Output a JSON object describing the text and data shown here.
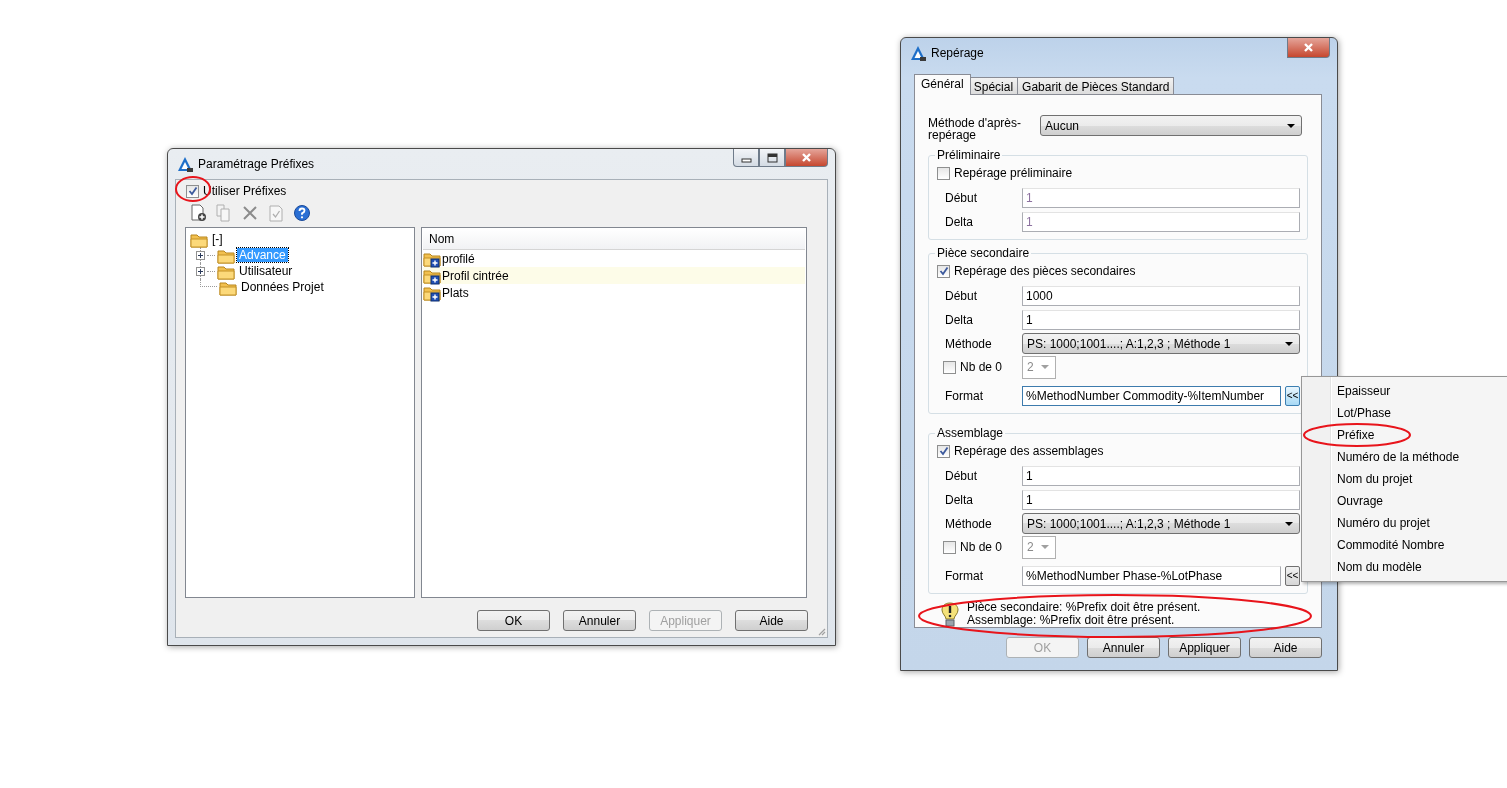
{
  "windows": [
    {
      "kind": "prefixes",
      "title": "Paramétrage Préfixes",
      "use_prefixes": {
        "label": "Utiliser Préfixes",
        "checked": true,
        "highlighted": true
      },
      "toolbar": [
        {
          "kind": "new",
          "disabled": false
        },
        {
          "kind": "copy",
          "disabled": true
        },
        {
          "kind": "delete",
          "disabled": true
        },
        {
          "kind": "check",
          "disabled": true
        },
        {
          "kind": "help",
          "disabled": false
        }
      ],
      "tree": [
        {
          "label": "[-]",
          "selected": false,
          "expandable": false,
          "children": [
            {
              "label": "Advance",
              "selected": true,
              "expandable": true
            },
            {
              "label": "Utilisateur",
              "selected": false,
              "expandable": true
            },
            {
              "label": "Données Projet",
              "selected": false,
              "expandable": false
            }
          ]
        }
      ],
      "list": {
        "columns": [
          "Nom"
        ],
        "rows": [
          {
            "name": "profilé",
            "hovered": false
          },
          {
            "name": "Profil cintrée",
            "hovered": true
          },
          {
            "name": "Plats",
            "hovered": false
          }
        ]
      },
      "buttons": [
        {
          "label": "OK",
          "disabled": false
        },
        {
          "label": "Annuler",
          "disabled": false
        },
        {
          "label": "Appliquer",
          "disabled": true
        },
        {
          "label": "Aide",
          "disabled": false
        }
      ]
    },
    {
      "kind": "numbering",
      "title": "Repérage",
      "tabs": [
        {
          "label": "Général",
          "selected": true
        },
        {
          "label": "Spécial",
          "selected": false
        },
        {
          "label": "Gabarit de Pièces Standard",
          "selected": false
        }
      ],
      "post_method": {
        "label": "Méthode d'après-repérage",
        "value": "Aucun"
      },
      "groups": [
        {
          "title": "Préliminaire",
          "option": {
            "label": "Repérage préliminaire",
            "checked": false
          },
          "fields": [
            {
              "kind": "text",
              "label": "Début",
              "value": "1",
              "disabled": true
            },
            {
              "kind": "text",
              "label": "Delta",
              "value": "1",
              "disabled": true
            }
          ]
        },
        {
          "title": "Pièce secondaire",
          "option": {
            "label": "Repérage des pièces secondaires",
            "checked": true
          },
          "fields": [
            {
              "kind": "text",
              "label": "Début",
              "value": "1000",
              "disabled": false
            },
            {
              "kind": "text",
              "label": "Delta",
              "value": "1",
              "disabled": false
            },
            {
              "kind": "combo",
              "label": "Méthode",
              "value": "PS: 1000;1001....; A:1,2,3 ; Méthode 1",
              "disabled": false
            },
            {
              "kind": "zeros",
              "label": "Nb de 0",
              "value": "2",
              "checked": false,
              "disabled": true
            },
            {
              "kind": "format",
              "label": "Format",
              "value": "%MethodNumber Commodity-%ItemNumber",
              "button": "<<",
              "focused": true,
              "disabled": false
            }
          ]
        },
        {
          "title": "Assemblage",
          "option": {
            "label": "Repérage des assemblages",
            "checked": true
          },
          "fields": [
            {
              "kind": "text",
              "label": "Début",
              "value": "1",
              "disabled": false
            },
            {
              "kind": "text",
              "label": "Delta",
              "value": "1",
              "disabled": false
            },
            {
              "kind": "combo",
              "label": "Méthode",
              "value": "PS: 1000;1001....; A:1,2,3 ; Méthode 1",
              "disabled": false
            },
            {
              "kind": "zeros",
              "label": "Nb de 0",
              "value": "2",
              "checked": false,
              "disabled": true
            },
            {
              "kind": "format",
              "label": "Format",
              "value": "%MethodNumber Phase-%LotPhase",
              "button": "<<",
              "focused": false,
              "disabled": false
            }
          ]
        }
      ],
      "message": {
        "lines": [
          "Pièce secondaire: %Prefix doit être présent.",
          "Assemblage: %Prefix doit être présent."
        ],
        "highlighted": true
      },
      "buttons": [
        {
          "label": "OK",
          "disabled": true
        },
        {
          "label": "Annuler",
          "disabled": false
        },
        {
          "label": "Appliquer",
          "disabled": false
        },
        {
          "label": "Aide",
          "disabled": false
        }
      ]
    }
  ],
  "context_menu": {
    "items": [
      {
        "label": "Epaisseur",
        "highlighted": false
      },
      {
        "label": "Lot/Phase",
        "highlighted": false
      },
      {
        "label": "Préfixe",
        "highlighted": true
      },
      {
        "label": "Numéro de la méthode",
        "highlighted": false
      },
      {
        "label": "Nom du projet",
        "highlighted": false
      },
      {
        "label": "Ouvrage",
        "highlighted": false
      },
      {
        "label": "Numéro du projet",
        "highlighted": false
      },
      {
        "label": "Commodité Nombre",
        "highlighted": false
      },
      {
        "label": "Nom du modèle",
        "highlighted": false
      }
    ]
  }
}
